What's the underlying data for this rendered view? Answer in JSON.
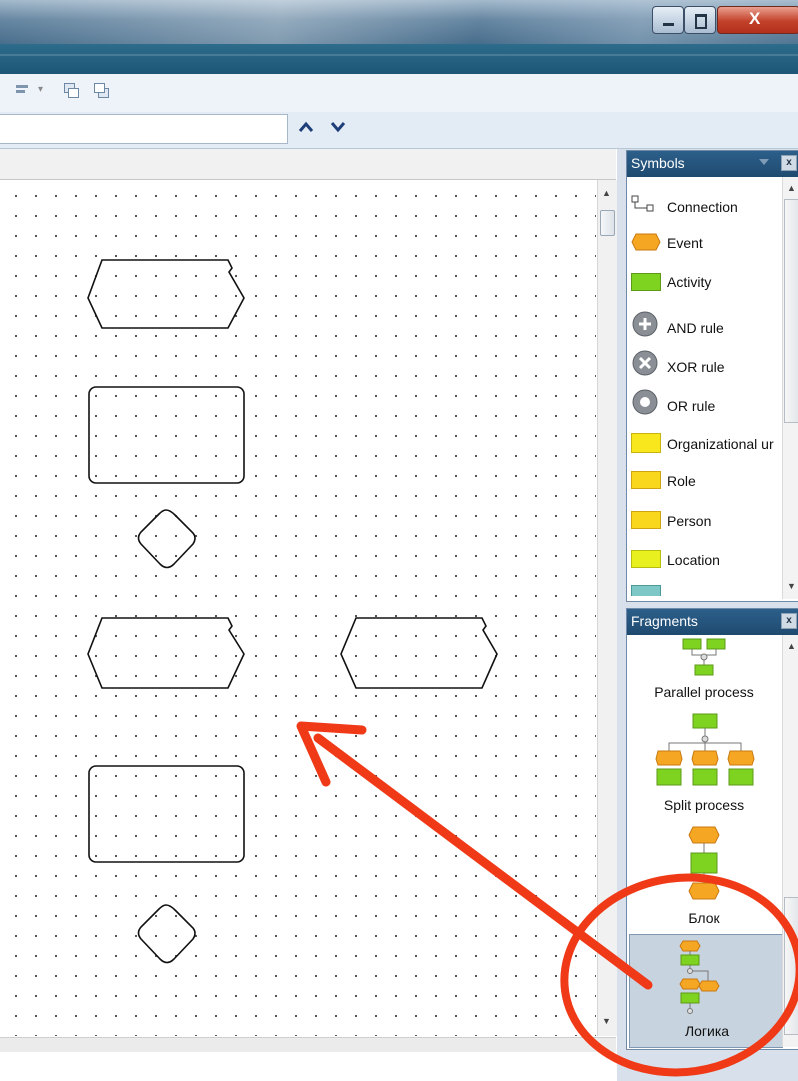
{
  "window": {
    "controls": {
      "minimize_icon": "minimize-icon",
      "maximize_icon": "maximize-icon",
      "close_label": "X"
    }
  },
  "toolbar": {
    "icons": [
      "align-icon",
      "dropdown-arrow-icon",
      "bring-to-front-icon",
      "send-to-back-icon"
    ]
  },
  "search": {
    "value": "",
    "up_icon": "chevron-up-icon",
    "down_icon": "chevron-down-icon"
  },
  "symbols_panel": {
    "title": "Symbols",
    "close_label": "x",
    "items": [
      {
        "label": "Connection",
        "icon": "connection-icon"
      },
      {
        "label": "Event",
        "icon": "event-hexagon-icon",
        "color": "#f5a623"
      },
      {
        "label": "Activity",
        "icon": "activity-rect-icon",
        "color": "#7ed321"
      },
      {
        "label": "AND rule",
        "icon": "and-rule-icon"
      },
      {
        "label": "XOR rule",
        "icon": "xor-rule-icon"
      },
      {
        "label": "OR rule",
        "icon": "or-rule-icon"
      },
      {
        "label": "Organizational ur",
        "icon": "org-unit-icon",
        "color": "#f8e71c"
      },
      {
        "label": "Role",
        "icon": "role-icon",
        "color": "#f8d71c"
      },
      {
        "label": "Person",
        "icon": "person-icon",
        "color": "#f8d71c"
      },
      {
        "label": "Location",
        "icon": "location-icon",
        "color": "#e8f020"
      }
    ]
  },
  "fragments_panel": {
    "title": "Fragments",
    "close_label": "x",
    "items": [
      {
        "label": "Parallel process"
      },
      {
        "label": "Split process"
      },
      {
        "label": "Блок"
      },
      {
        "label": "Логика",
        "selected": true
      }
    ]
  },
  "colors": {
    "event": "#f5a623",
    "activity": "#7ed321",
    "annotation": "#f03a17"
  }
}
